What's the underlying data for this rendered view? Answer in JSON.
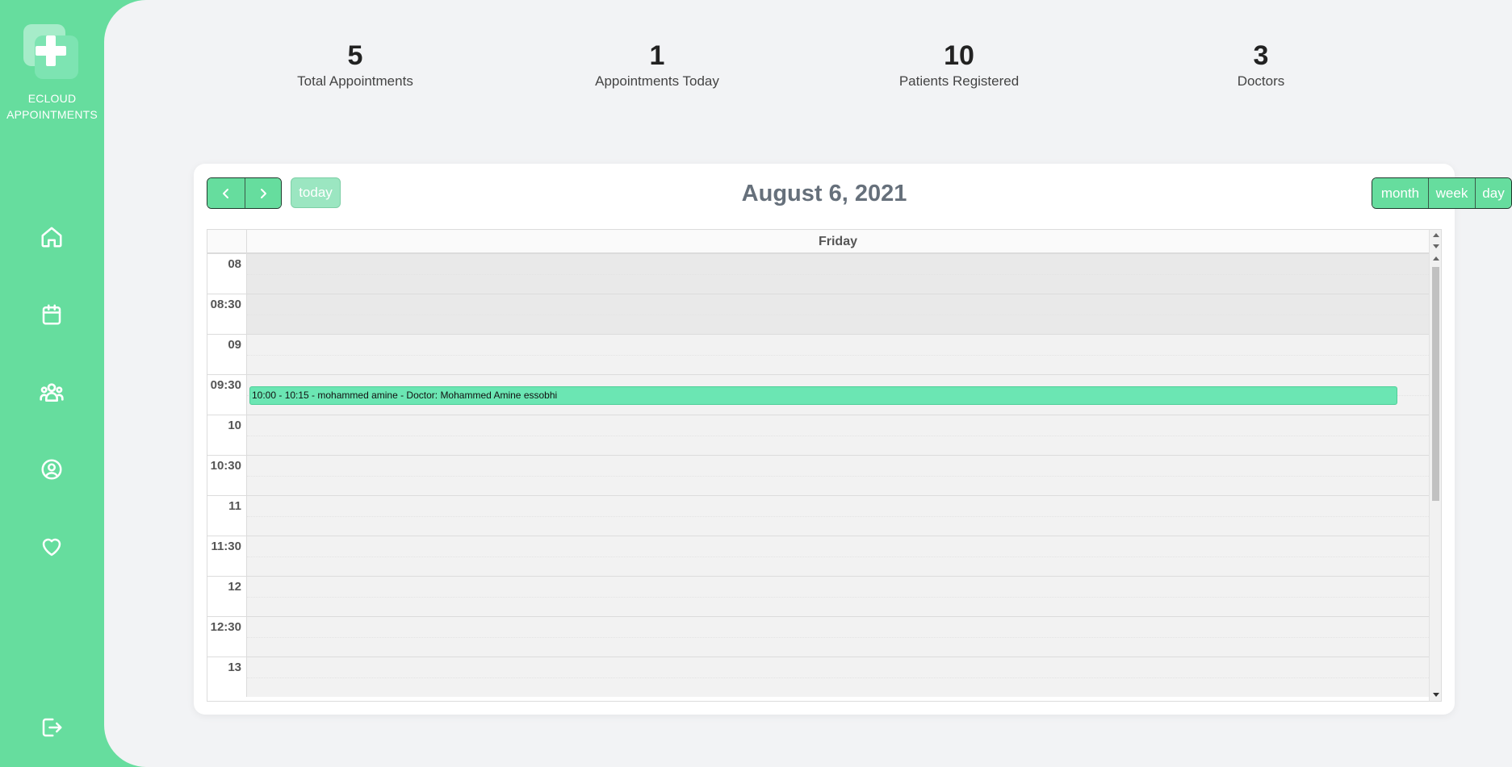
{
  "app": {
    "name": "ECLOUD APPOINTMENTS",
    "name_line1": "ECLOUD",
    "name_line2": "APPOINTMENTS"
  },
  "sidebar": {
    "items": [
      {
        "icon": "home-icon"
      },
      {
        "icon": "calendar-icon"
      },
      {
        "icon": "patients-icon"
      },
      {
        "icon": "profile-icon"
      },
      {
        "icon": "heart-icon"
      }
    ],
    "logout_icon": "logout-icon"
  },
  "stats": [
    {
      "value": "5",
      "label": "Total Appointments"
    },
    {
      "value": "1",
      "label": "Appointments Today"
    },
    {
      "value": "10",
      "label": "Patients Registered"
    },
    {
      "value": "3",
      "label": "Doctors"
    }
  ],
  "calendar": {
    "title": "August 6, 2021",
    "today_label": "today",
    "views": {
      "month": "month",
      "week": "week",
      "day": "day"
    },
    "day_header": "Friday",
    "slots": [
      "08",
      "08:30",
      "09",
      "09:30",
      "10",
      "10:30",
      "11",
      "11:30",
      "12",
      "12:30",
      "13"
    ],
    "event": {
      "text": "10:00 - 10:15 - mohammed amine - Doctor: Mohammed Amine essobhi"
    }
  },
  "colors": {
    "accent": "#66dd9e",
    "event": "#6be6b3",
    "main_bg": "#f2f3f5"
  }
}
